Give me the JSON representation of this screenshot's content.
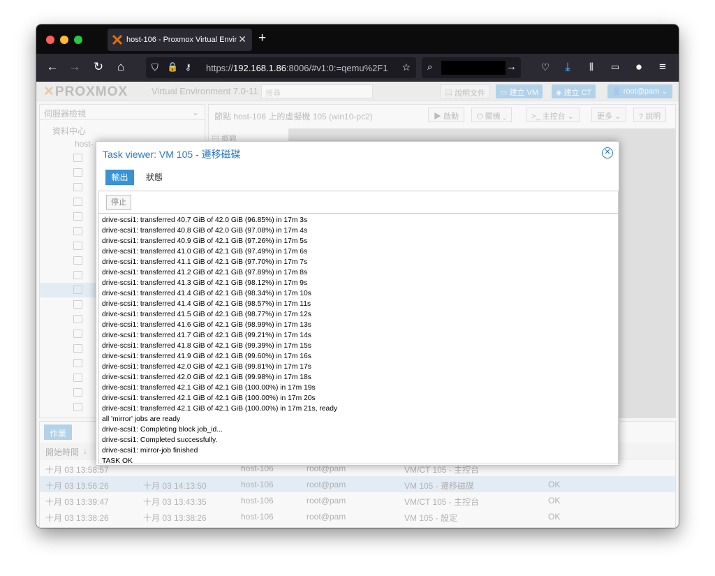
{
  "browser": {
    "tab_title": "host-106 - Proxmox Virtual Envir",
    "url_prefix": "https://",
    "url_host": "192.168.1.86",
    "url_rest": ":8006/#v1:0:=qemu%2F1"
  },
  "pve": {
    "logo": "PROXMOX",
    "version": "Virtual Environment 7.0-11",
    "search_placeholder": "搜尋",
    "docs": "說明文件",
    "create_vm": "建立 VM",
    "create_ct": "建立 CT",
    "user": "root@pam",
    "server_view": "伺服器檢視",
    "datacenter": "資料中心",
    "node": "host-",
    "right_title": "節點 host-106 上的虛擬機 105 (win10-pc2)",
    "start": "啟動",
    "shutdown": "關機",
    "console": "主控台",
    "more": "更多",
    "help": "說明",
    "summary": "概觀",
    "bottom_tab_tasks": "作業",
    "col_start": "開始時間",
    "tasks": [
      {
        "start": "十月 03 13:58:57",
        "end": "",
        "node": "host-106",
        "user": "root@pam",
        "desc": "VM/CT 105 - 主控台",
        "status": ""
      },
      {
        "start": "十月 03 13:56:26",
        "end": "十月 03 14:13:50",
        "node": "host-106",
        "user": "root@pam",
        "desc": "VM 105 - 遷移磁碟",
        "status": "OK"
      },
      {
        "start": "十月 03 13:39:47",
        "end": "十月 03 13:43:35",
        "node": "host-106",
        "user": "root@pam",
        "desc": "VM/CT 105 - 主控台",
        "status": "OK"
      },
      {
        "start": "十月 03 13:38:26",
        "end": "十月 03 13:38:26",
        "node": "host-106",
        "user": "root@pam",
        "desc": "VM 105 - 設定",
        "status": "OK"
      }
    ]
  },
  "modal": {
    "title": "Task viewer: VM 105 - 遷移磁碟",
    "tab_output": "輸出",
    "tab_status": "狀態",
    "stop": "停止",
    "log": [
      "drive-scsi1: transferred 40.7 GiB of 42.0 GiB (96.85%) in 17m 3s",
      "drive-scsi1: transferred 40.8 GiB of 42.0 GiB (97.08%) in 17m 4s",
      "drive-scsi1: transferred 40.9 GiB of 42.1 GiB (97.26%) in 17m 5s",
      "drive-scsi1: transferred 41.0 GiB of 42.1 GiB (97.49%) in 17m 6s",
      "drive-scsi1: transferred 41.1 GiB of 42.1 GiB (97.70%) in 17m 7s",
      "drive-scsi1: transferred 41.2 GiB of 42.1 GiB (97.89%) in 17m 8s",
      "drive-scsi1: transferred 41.3 GiB of 42.1 GiB (98.12%) in 17m 9s",
      "drive-scsi1: transferred 41.4 GiB of 42.1 GiB (98.34%) in 17m 10s",
      "drive-scsi1: transferred 41.4 GiB of 42.1 GiB (98.57%) in 17m 11s",
      "drive-scsi1: transferred 41.5 GiB of 42.1 GiB (98.77%) in 17m 12s",
      "drive-scsi1: transferred 41.6 GiB of 42.1 GiB (98.99%) in 17m 13s",
      "drive-scsi1: transferred 41.7 GiB of 42.1 GiB (99.21%) in 17m 14s",
      "drive-scsi1: transferred 41.8 GiB of 42.1 GiB (99.39%) in 17m 15s",
      "drive-scsi1: transferred 41.9 GiB of 42.1 GiB (99.60%) in 17m 16s",
      "drive-scsi1: transferred 42.0 GiB of 42.1 GiB (99.81%) in 17m 17s",
      "drive-scsi1: transferred 42.0 GiB of 42.1 GiB (99.98%) in 17m 18s",
      "drive-scsi1: transferred 42.1 GiB of 42.1 GiB (100.00%) in 17m 19s",
      "drive-scsi1: transferred 42.1 GiB of 42.1 GiB (100.00%) in 17m 20s",
      "drive-scsi1: transferred 42.1 GiB of 42.1 GiB (100.00%) in 17m 21s, ready",
      "all 'mirror' jobs are ready",
      "drive-scsi1: Completing block job_id...",
      "drive-scsi1: Completed successfully.",
      "drive-scsi1: mirror-job finished",
      "TASK OK"
    ]
  },
  "colors": {
    "accent": "#3892d4",
    "title": "#2b78c5",
    "brand": "#e57000"
  }
}
